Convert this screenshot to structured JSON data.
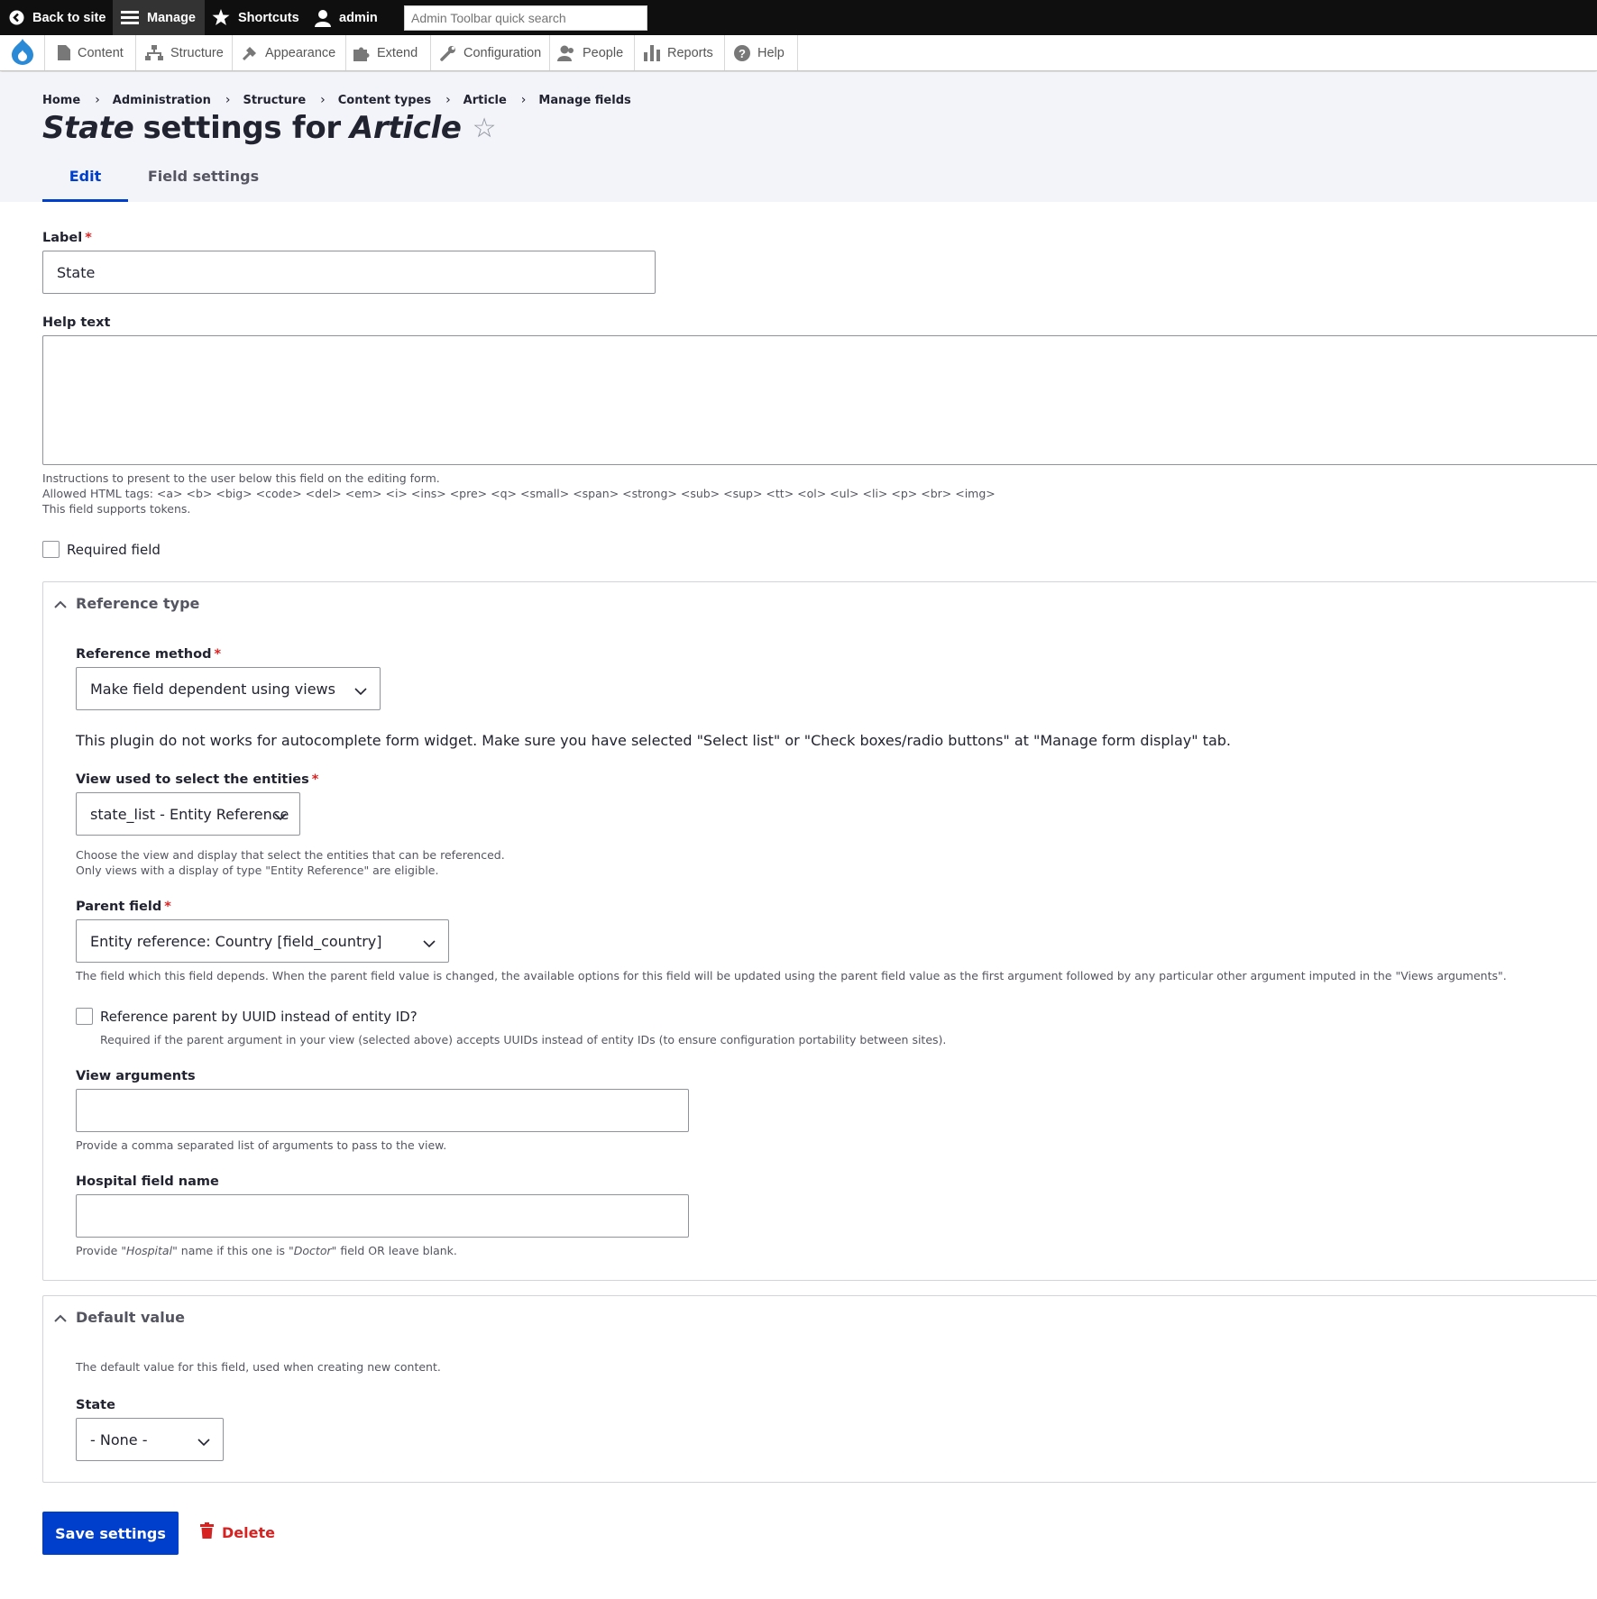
{
  "toolbar": {
    "back_label": "Back to site",
    "manage_label": "Manage",
    "shortcuts_label": "Shortcuts",
    "user_label": "admin",
    "search_placeholder": "Admin Toolbar quick search"
  },
  "tray": {
    "items": [
      {
        "label": "Content",
        "icon": "content-icon"
      },
      {
        "label": "Structure",
        "icon": "structure-icon"
      },
      {
        "label": "Appearance",
        "icon": "appearance-icon"
      },
      {
        "label": "Extend",
        "icon": "extend-icon"
      },
      {
        "label": "Configuration",
        "icon": "configuration-icon"
      },
      {
        "label": "People",
        "icon": "people-icon"
      },
      {
        "label": "Reports",
        "icon": "reports-icon"
      },
      {
        "label": "Help",
        "icon": "help-icon"
      }
    ]
  },
  "breadcrumb": [
    "Home",
    "Administration",
    "Structure",
    "Content types",
    "Article",
    "Manage fields"
  ],
  "title": {
    "field": "State",
    "middle": "settings for",
    "bundle": "Article"
  },
  "tabs": [
    "Edit",
    "Field settings"
  ],
  "form": {
    "label_title": "Label",
    "label_value": "State",
    "help_title": "Help text",
    "help_value": "",
    "help_desc_1": "Instructions to present to the user below this field on the editing form.",
    "help_desc_2": "Allowed HTML tags: <a> <b> <big> <code> <del> <em> <i> <ins> <pre> <q> <small> <span> <strong> <sub> <sup> <tt> <ol> <ul> <li> <p> <br> <img>",
    "help_desc_3": "This field supports tokens.",
    "required_label": "Required field",
    "required_checked": false
  },
  "reference": {
    "legend": "Reference type",
    "method_label": "Reference method",
    "method_value": "Make field dependent using views",
    "note": "This plugin do not works for autocomplete form widget. Make sure you have selected \"Select list\" or \"Check boxes/radio buttons\" at \"Manage form display\" tab.",
    "view_label": "View used to select the entities",
    "view_value": "state_list - Entity Reference",
    "view_desc_1": "Choose the view and display that select the entities that can be referenced.",
    "view_desc_2": "Only views with a display of type \"Entity Reference\" are eligible.",
    "parent_label": "Parent field",
    "parent_value": "Entity reference: Country [field_country]",
    "parent_desc": "The field which this field depends. When the parent field value is changed, the available options for this field will be updated using the parent field value as the first argument followed by any particular other argument imputed in the \"Views arguments\".",
    "uuid_label": "Reference parent by UUID instead of entity ID?",
    "uuid_checked": false,
    "uuid_desc": "Required if the parent argument in your view (selected above) accepts UUIDs instead of entity IDs (to ensure configuration portability between sites).",
    "args_label": "View arguments",
    "args_value": "",
    "args_desc": "Provide a comma separated list of arguments to pass to the view.",
    "hospital_label": "Hospital field name",
    "hospital_value": "",
    "hospital_desc_pre": "Provide ",
    "hospital_desc_em1": "\"Hospital\"",
    "hospital_desc_mid": " name if this one is ",
    "hospital_desc_em2": "\"Doctor\"",
    "hospital_desc_post": " field OR leave blank."
  },
  "default_value": {
    "legend": "Default value",
    "desc": "The default value for this field, used when creating new content.",
    "state_label": "State",
    "state_value": "- None -"
  },
  "actions": {
    "save": "Save settings",
    "delete": "Delete"
  },
  "colors": {
    "accent": "#003ecc",
    "danger": "#d72222",
    "header_bg": "#f3f4f9",
    "toolbar_bg": "#0f0f0f"
  }
}
